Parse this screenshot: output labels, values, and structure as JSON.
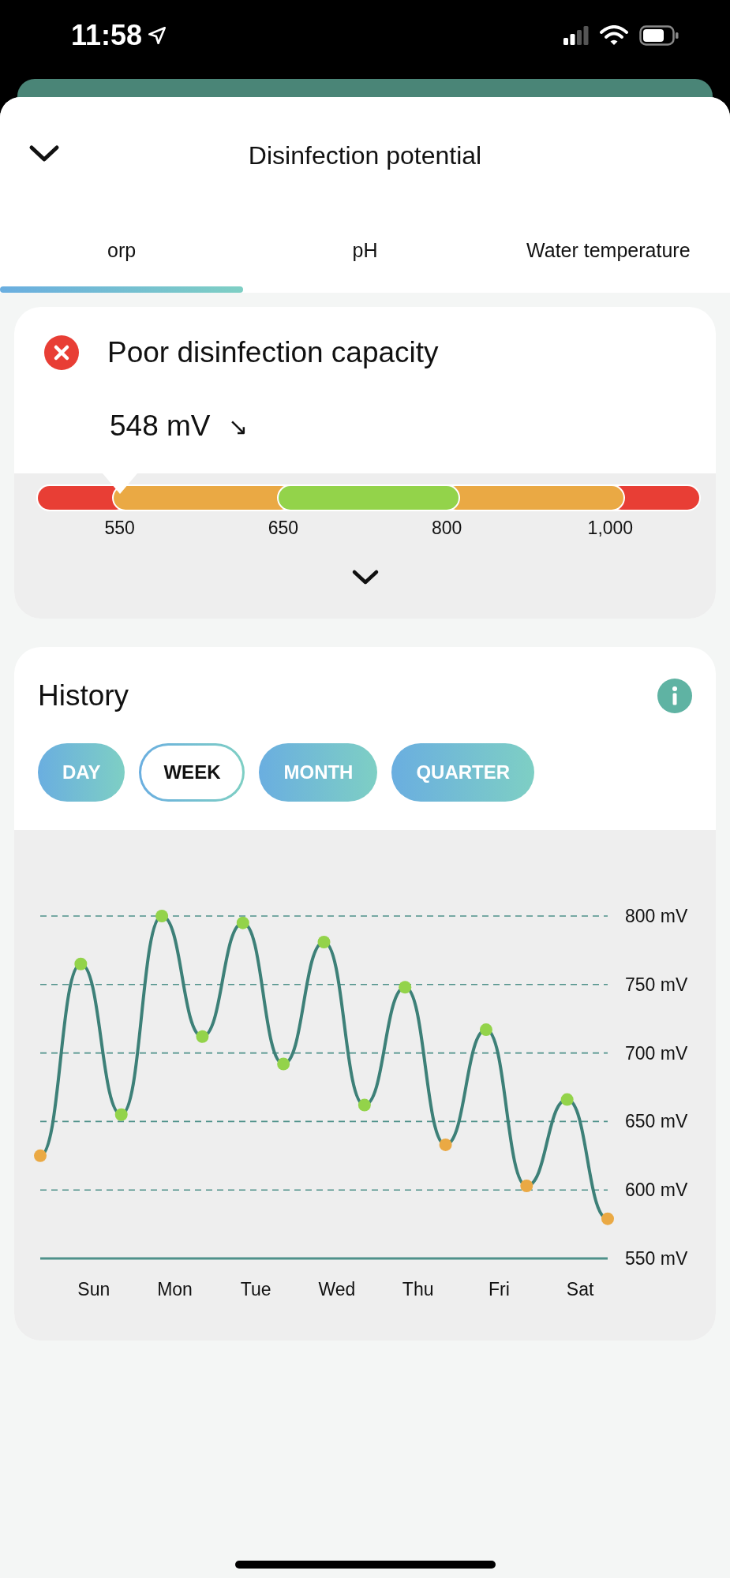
{
  "status_bar": {
    "time": "11:58"
  },
  "header": {
    "title": "Disinfection potential",
    "collapsed": true
  },
  "tabs": [
    {
      "label": "orp",
      "selected": true
    },
    {
      "label": "pH",
      "selected": false
    },
    {
      "label": "Water temperature",
      "selected": false
    }
  ],
  "status_card": {
    "title": "Poor disinfection capacity",
    "reading": "548 mV",
    "trend": "↘",
    "expanded": false,
    "gauge": {
      "level": 0.125,
      "segments": [
        {
          "color": "#e83e35"
        },
        {
          "color": "#eaa944"
        },
        {
          "color": "#93d34a"
        },
        {
          "color": "#eaa944"
        },
        {
          "color": "#e83e35"
        }
      ],
      "ticks": [
        "550",
        "650",
        "800",
        "1,000"
      ]
    }
  },
  "history": {
    "title": "History",
    "ranges": [
      {
        "label": "DAY",
        "selected": false
      },
      {
        "label": "WEEK",
        "selected": true
      },
      {
        "label": "MONTH",
        "selected": false
      },
      {
        "label": "QUARTER",
        "selected": false
      }
    ],
    "chart_data": {
      "type": "line",
      "grid": true,
      "ylim": [
        550,
        800
      ],
      "categories": [
        null,
        "Sun",
        null,
        "Mon",
        null,
        "Tue",
        null,
        "Wed",
        null,
        "Thu",
        null,
        "Fri",
        null,
        "Sat",
        null
      ],
      "series": [
        {
          "color": "#3d8078",
          "marker": true,
          "values": [
            625,
            765,
            655,
            800,
            712,
            795,
            692,
            781,
            662,
            748,
            633,
            717,
            603,
            666,
            579
          ]
        }
      ],
      "yticks": [
        {
          "value": 800,
          "label": "800 mV"
        },
        {
          "value": 750,
          "label": "750 mV"
        },
        {
          "value": 700,
          "label": "700 mV"
        },
        {
          "value": 650,
          "label": "650 mV"
        },
        {
          "value": 600,
          "label": "600 mV"
        },
        {
          "value": 550,
          "label": "550 mV"
        }
      ]
    }
  }
}
